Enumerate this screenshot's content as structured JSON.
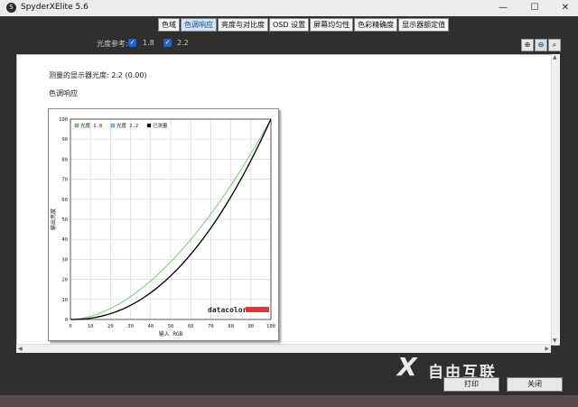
{
  "window": {
    "title": "SpyderXElite 5.6",
    "icon_letter": "S"
  },
  "controls": {
    "minimize": "—",
    "maximize": "☐",
    "close": "✕"
  },
  "tabs": [
    {
      "label": "色域",
      "active": false
    },
    {
      "label": "色调响应",
      "active": true
    },
    {
      "label": "亮度与对比度",
      "active": false
    },
    {
      "label": "OSD 设置",
      "active": false
    },
    {
      "label": "屏幕均匀性",
      "active": false
    },
    {
      "label": "色彩精确度",
      "active": false
    },
    {
      "label": "显示器额定值",
      "active": false
    }
  ],
  "reference": {
    "label": "光度参考:",
    "option1": {
      "label": "1.8",
      "checked": true
    },
    "option2": {
      "label": "2.2",
      "checked": true
    }
  },
  "measured_text": "测量的显示器光度:  2.2 (0.00)",
  "section_title": "色调响应",
  "chart_data": {
    "type": "line",
    "xlabel": "输入 RGB",
    "ylabel": "输出亮度",
    "xlim": [
      0,
      100
    ],
    "ylim": [
      0,
      100
    ],
    "grid": true,
    "legend_position": "top-left",
    "xticks": [
      0,
      10,
      20,
      30,
      40,
      50,
      60,
      70,
      80,
      90,
      100
    ],
    "yticks": [
      0,
      10,
      20,
      30,
      40,
      50,
      60,
      70,
      80,
      90,
      100
    ],
    "series": [
      {
        "name": "光度 1.8",
        "color": "#7fd07f",
        "gamma": 1.8
      },
      {
        "name": "光度 2.2",
        "color": "#7fc8e8",
        "gamma": 2.2
      },
      {
        "name": "已测量",
        "color": "#000000",
        "gamma": 2.2
      }
    ],
    "brand": "datacolor",
    "brand_bar_color": "#d63a3a"
  },
  "buttons": {
    "print": "打印",
    "close": "关闭"
  },
  "watermark": {
    "x": "X",
    "text": "自由互联"
  }
}
